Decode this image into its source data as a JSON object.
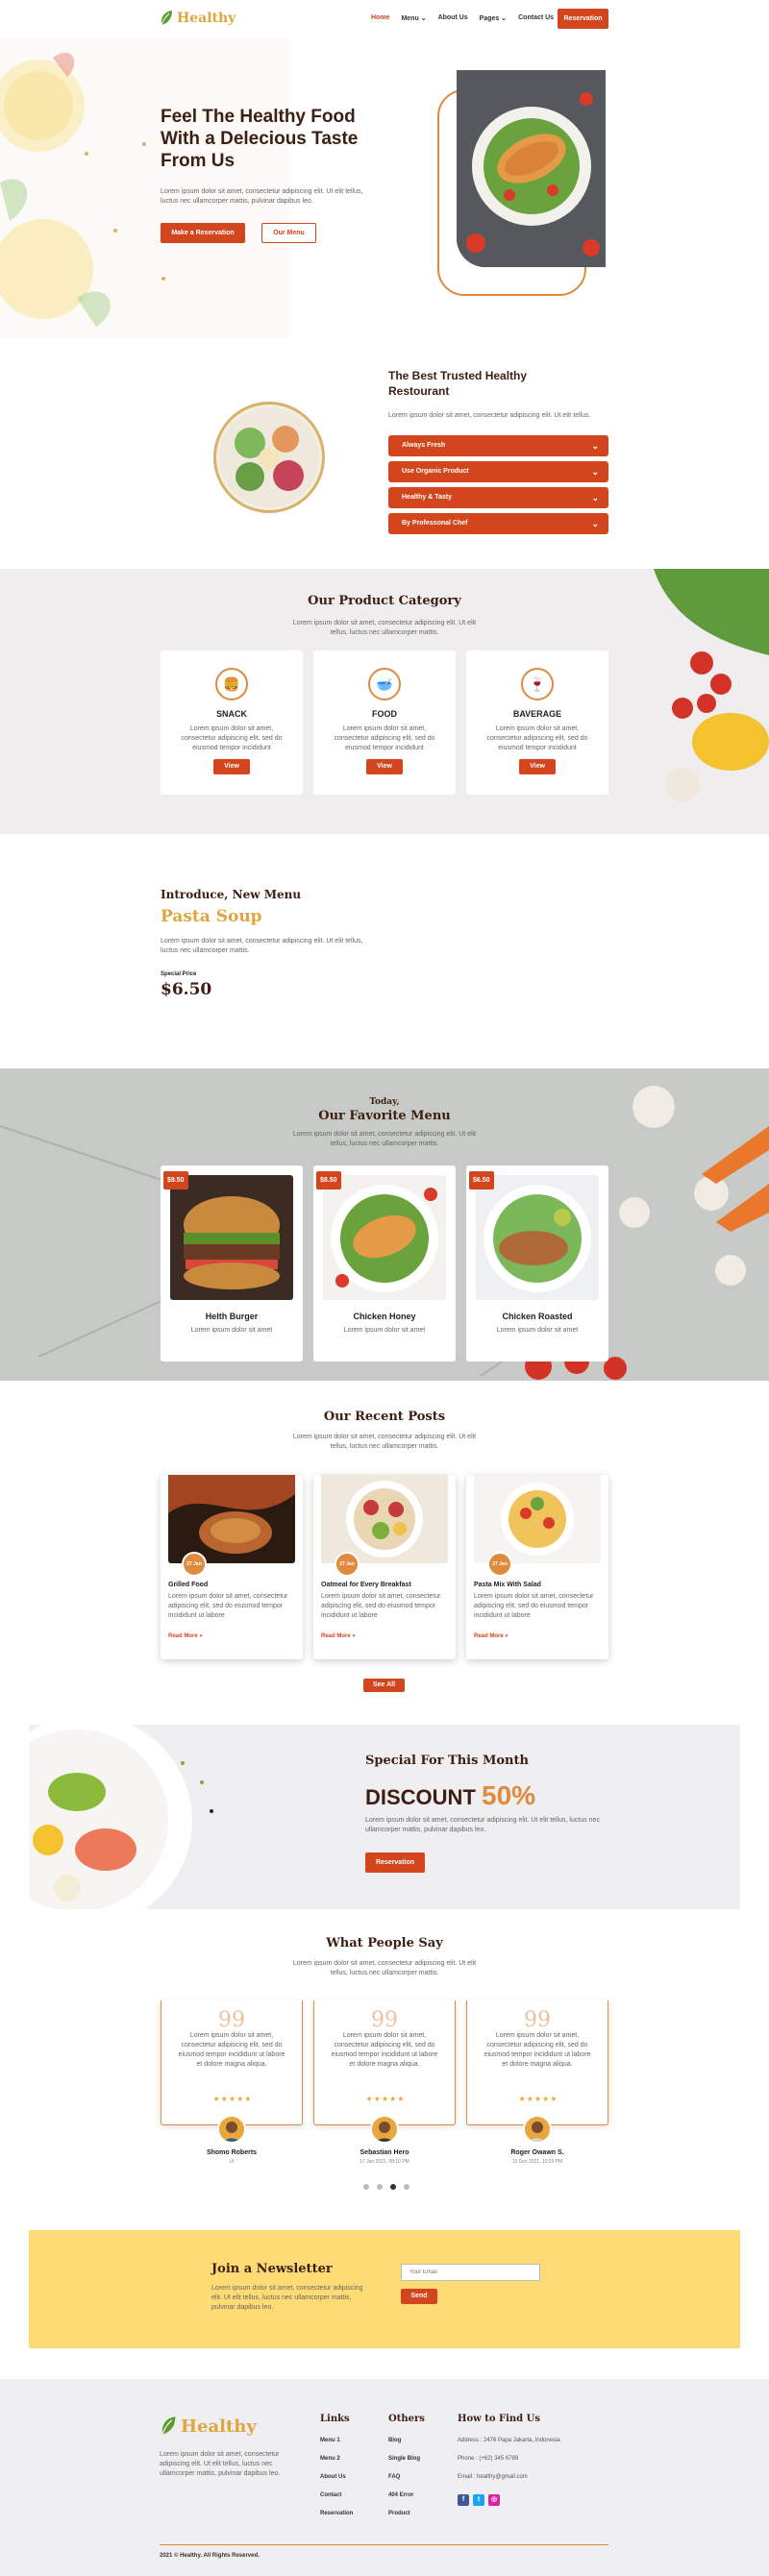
{
  "header": {
    "logo": "Healthy",
    "nav": [
      "Home",
      "Menu",
      "About Us",
      "Pages",
      "Contact Us"
    ],
    "reservation": "Reservation"
  },
  "hero": {
    "title": "Feel The Healthy Food With a Delecious Taste From Us",
    "text": "Lorem ipsum dolor sit amet, consectetur adipiscing elit. Ut elit tellus, luctus nec ullamcorper mattis, pulvinar dapibus leo.",
    "btn_primary": "Make a Reservation",
    "btn_secondary": "Our Menu"
  },
  "trusted": {
    "title": "The Best Trusted Healthy Restourant",
    "text": "Lorem ipsum dolor sit amet, consectetur adipiscing elit. Ut elit tellus.",
    "items": [
      "Always Fresh",
      "Use Organic Product",
      "Healthy & Tasty",
      "By Professonal Chef"
    ]
  },
  "category": {
    "title": "Our Product Category",
    "subtitle": "Lorem ipsum dolor sit amet, consectetur adipiscing elit. Ut elit tellus, luctus nec ullamcorper mattis.",
    "cards": [
      {
        "name": "SNACK",
        "icon": "burger-icon",
        "text": "Lorem ipsum dolor sit amet, consectetur adipiscing elit, sed do eiusmod tempor incididunt",
        "button": "View"
      },
      {
        "name": "FOOD",
        "icon": "mortar-icon",
        "text": "Lorem ipsum dolor sit amet, consectetur adipiscing elit, sed do eiusmod tempor incididunt",
        "button": "View"
      },
      {
        "name": "BAVERAGE",
        "icon": "glass-icon",
        "text": "Lorem ipsum dolor sit amet, consectetur adipiscing elit, sed do eiusmod tempor incididunt",
        "button": "View"
      }
    ]
  },
  "newmenu": {
    "subtitle": "Introduce, New Menu",
    "title": "Pasta Soup",
    "text": "Lorem ipsum dolor sit amet, consectetur adipiscing elit. Ut elit tellus, luctus nec ullamcorper mattis.",
    "label": "Special Price",
    "price": "$6.50"
  },
  "favorite": {
    "title_top": "Today,",
    "title": "Our Favorite Menu",
    "subtitle": "Lorem ipsum dolor sit amet, consectetur adipiscing elit. Ut elit tellus, luctus nec ullamcorper mattis.",
    "items": [
      {
        "price": "$9.50",
        "name": "Helth Burger",
        "text": "Lorem ipsum dolor sit amet"
      },
      {
        "price": "$8.50",
        "name": "Chicken Honey",
        "text": "Lorem ipsum dolor sit amet"
      },
      {
        "price": "$6.50",
        "name": "Chicken Roasted",
        "text": "Lorem ipsum dolor sit amet"
      }
    ]
  },
  "posts": {
    "title": "Our Recent Posts",
    "subtitle": "Lorem ipsum dolor sit amet, consectetur adipiscing elit. Ut elit tellus, luctus nec ullamcorper mattis.",
    "items": [
      {
        "date": "27 Jan",
        "title": "Grilled Food",
        "text": "Lorem ipsum dolor sit amet, consectetur adipiscing elit, sed do eiusmod tempor incididunt ut labore",
        "link": "Read More »"
      },
      {
        "date": "27 Jan",
        "title": "Oatmeal for Every Breakfast",
        "text": "Lorem ipsum dolor sit amet, consectetur adipiscing elit, sed do eiusmod tempor incididunt ut labore",
        "link": "Read More »"
      },
      {
        "date": "27 Jan",
        "title": "Pasta Mix With Salad",
        "text": "Lorem ipsum dolor sit amet, consectetur adipiscing elit, sed do eiusmod tempor incididunt ut labore",
        "link": "Read More »"
      }
    ],
    "see_all": "See All"
  },
  "special": {
    "title": "Special For This Month",
    "discount_label": "DISCOUNT",
    "discount_value": "50%",
    "text": "Lorem ipsum dolor sit amet, consectetur adipiscing elit. Ut elit tellus, luctus nec ullamcorper mattis, pulvinar dapibus leo.",
    "button": "Reservation"
  },
  "testimonials": {
    "title": "What People Say",
    "subtitle": "Lorem ipsum dolor sit amet, consectetur adipiscing elit. Ut elit tellus, luctus nec ullamcorper mattis.",
    "items": [
      {
        "text": "Lorem ipsum dolor sit amet, consectetur adipiscing elit, sed do eiusmod tempor incididunt ut labore et dolore magna aliqua.",
        "name": "Shomo Roberts",
        "role": "UI"
      },
      {
        "text": "Lorem ipsum dolor sit amet, consectetur adipiscing elit, sed do eiusmod tempor incididunt ut labore et dolore magna aliqua.",
        "name": "Sebastian Hero",
        "role": "17 Jan 2021, 08:10 PM"
      },
      {
        "text": "Lorem ipsum dolor sit amet, consectetur adipiscing elit, sed do eiusmod tempor incididunt ut labore et dolore magna aliqua.",
        "name": "Roger Owawn S.",
        "role": "13 Des 2021, 10:29 PM"
      }
    ],
    "stars": "★★★★★"
  },
  "newsletter": {
    "title": "Join a Newsletter",
    "text": "Lorem ipsum dolor sit amet, consectetur adipiscing elit. Ut elit tellus, luctus nec ullamcorper mattis, pulvinar dapibus leo.",
    "placeholder": "Your Email",
    "button": "Send"
  },
  "footer": {
    "logo": "Healthy",
    "text": "Lorem ipsum dolor sit amet, consectetur adipiscing elit. Ut elit tellus, luctus nec ullamcorper mattis, pulvinar dapibus leo.",
    "links_title": "Links",
    "links": [
      "Menu 1",
      "Menu 2",
      "About Us",
      "Contact",
      "Reservation"
    ],
    "others_title": "Others",
    "others": [
      "Blog",
      "Single Blog",
      "FAQ",
      "404 Error",
      "Product"
    ],
    "find_title": "How to Find Us",
    "address": "Address : 2476 Papa Jakarta, Indonesia",
    "phone": "Phone : (+62) 345 6789",
    "email": "Email : healthy@gmail.com",
    "copyright": "2021 © Healthy. All Rights Reserved."
  },
  "colors": {
    "accent": "#d3451d",
    "brand": "#e1a43e",
    "dark": "#3d1e12"
  }
}
